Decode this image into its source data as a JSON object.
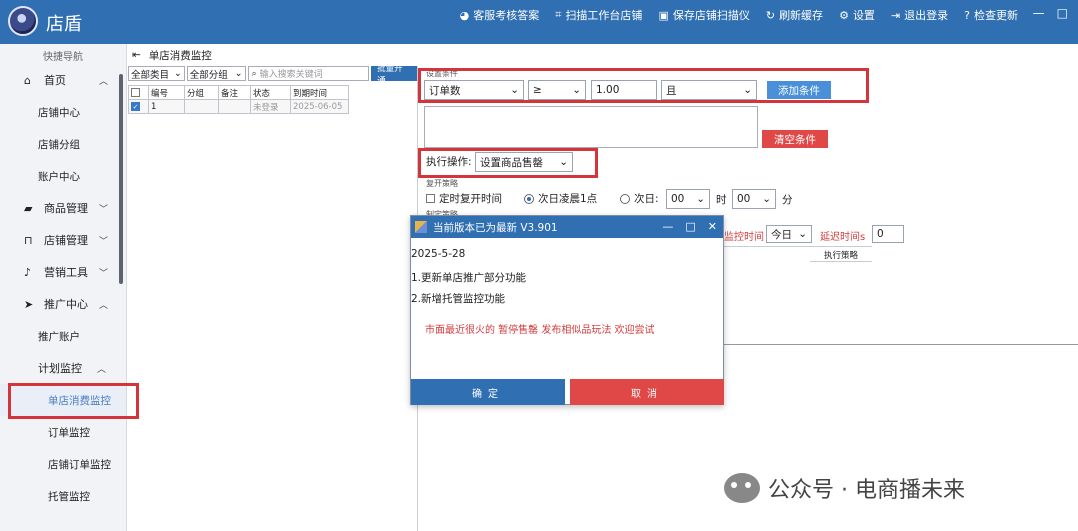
{
  "app": {
    "title": "店盾"
  },
  "toolbar": [
    {
      "icon": "pie-chart-icon",
      "glyph": "◕",
      "label": "客服考核答案"
    },
    {
      "icon": "scan-icon",
      "glyph": "⌗",
      "label": "扫描工作台店铺"
    },
    {
      "icon": "save-icon",
      "glyph": "▣",
      "label": "保存店铺扫描仪"
    },
    {
      "icon": "refresh-icon",
      "glyph": "↻",
      "label": "刷新缓存"
    },
    {
      "icon": "gear-icon",
      "glyph": "⚙",
      "label": "设置"
    },
    {
      "icon": "logout-icon",
      "glyph": "⇥",
      "label": "退出登录"
    },
    {
      "icon": "question-icon",
      "glyph": "?",
      "label": "检查更新"
    }
  ],
  "window": {
    "minimize": "—",
    "maximize": "□"
  },
  "sidebar": {
    "header": "快捷导航",
    "home": "首页",
    "home_items": [
      "店铺中心",
      "店铺分组",
      "账户中心"
    ],
    "goods": "商品管理",
    "shop": "店铺管理",
    "marketing": "营销工具",
    "promo": "推广中心",
    "promo_items": [
      "推广账户"
    ],
    "plan": "计划监控",
    "plan_items": [
      "单店消费监控",
      "订单监控",
      "店铺订单监控",
      "托管监控"
    ]
  },
  "breadcrumb": {
    "icon": "menu-fold-icon",
    "title": "单店消费监控"
  },
  "list": {
    "filter_category": "全部类目",
    "filter_group": "全部分组",
    "search_placeholder": "输入搜索关键词",
    "batch_button": "批量开通",
    "columns": [
      "编号",
      "分组",
      "备注",
      "状态",
      "到期时间"
    ],
    "rows": [
      {
        "id": "1",
        "group": "",
        "note": "",
        "status": "未登录",
        "expire": "2025-06-05"
      }
    ]
  },
  "panel": {
    "condition_title": "设置条件",
    "field": "订单数",
    "operator": "≥",
    "value": "1.00",
    "logic": "且",
    "add_button": "添加条件",
    "clear_button": "清空条件",
    "action_label": "执行操作:",
    "action_value": "设置商品售罄",
    "strategy_title": "复开策略",
    "opt_timed": "定时复开时间",
    "opt_next_day": "次日凌晨1点",
    "opt_day": "次日:",
    "hour": "00",
    "hour_unit": "时",
    "minute": "00",
    "minute_unit": "分",
    "rule_title": "制定策略",
    "monitor_time_label": "监控时间",
    "monitor_time_value": "今日",
    "delay_label": "延迟时间s",
    "delay_value": "0",
    "col_strategy": "执行策略"
  },
  "dialog": {
    "title": "当前版本已为最新 V3.901",
    "date": "2025-5-28",
    "line1": "1.更新单店推广部分功能",
    "line2": "2.新增托管监控功能",
    "promo": "市面最近很火的 暂停售罄 发布相似品玩法 欢迎尝试",
    "ok": "确定",
    "cancel": "取消"
  },
  "watermark": {
    "text": "公众号 · 电商播未来"
  },
  "colors": {
    "brand": "#2f6fb2",
    "danger": "#e04848",
    "highlight": "#d4353a"
  }
}
